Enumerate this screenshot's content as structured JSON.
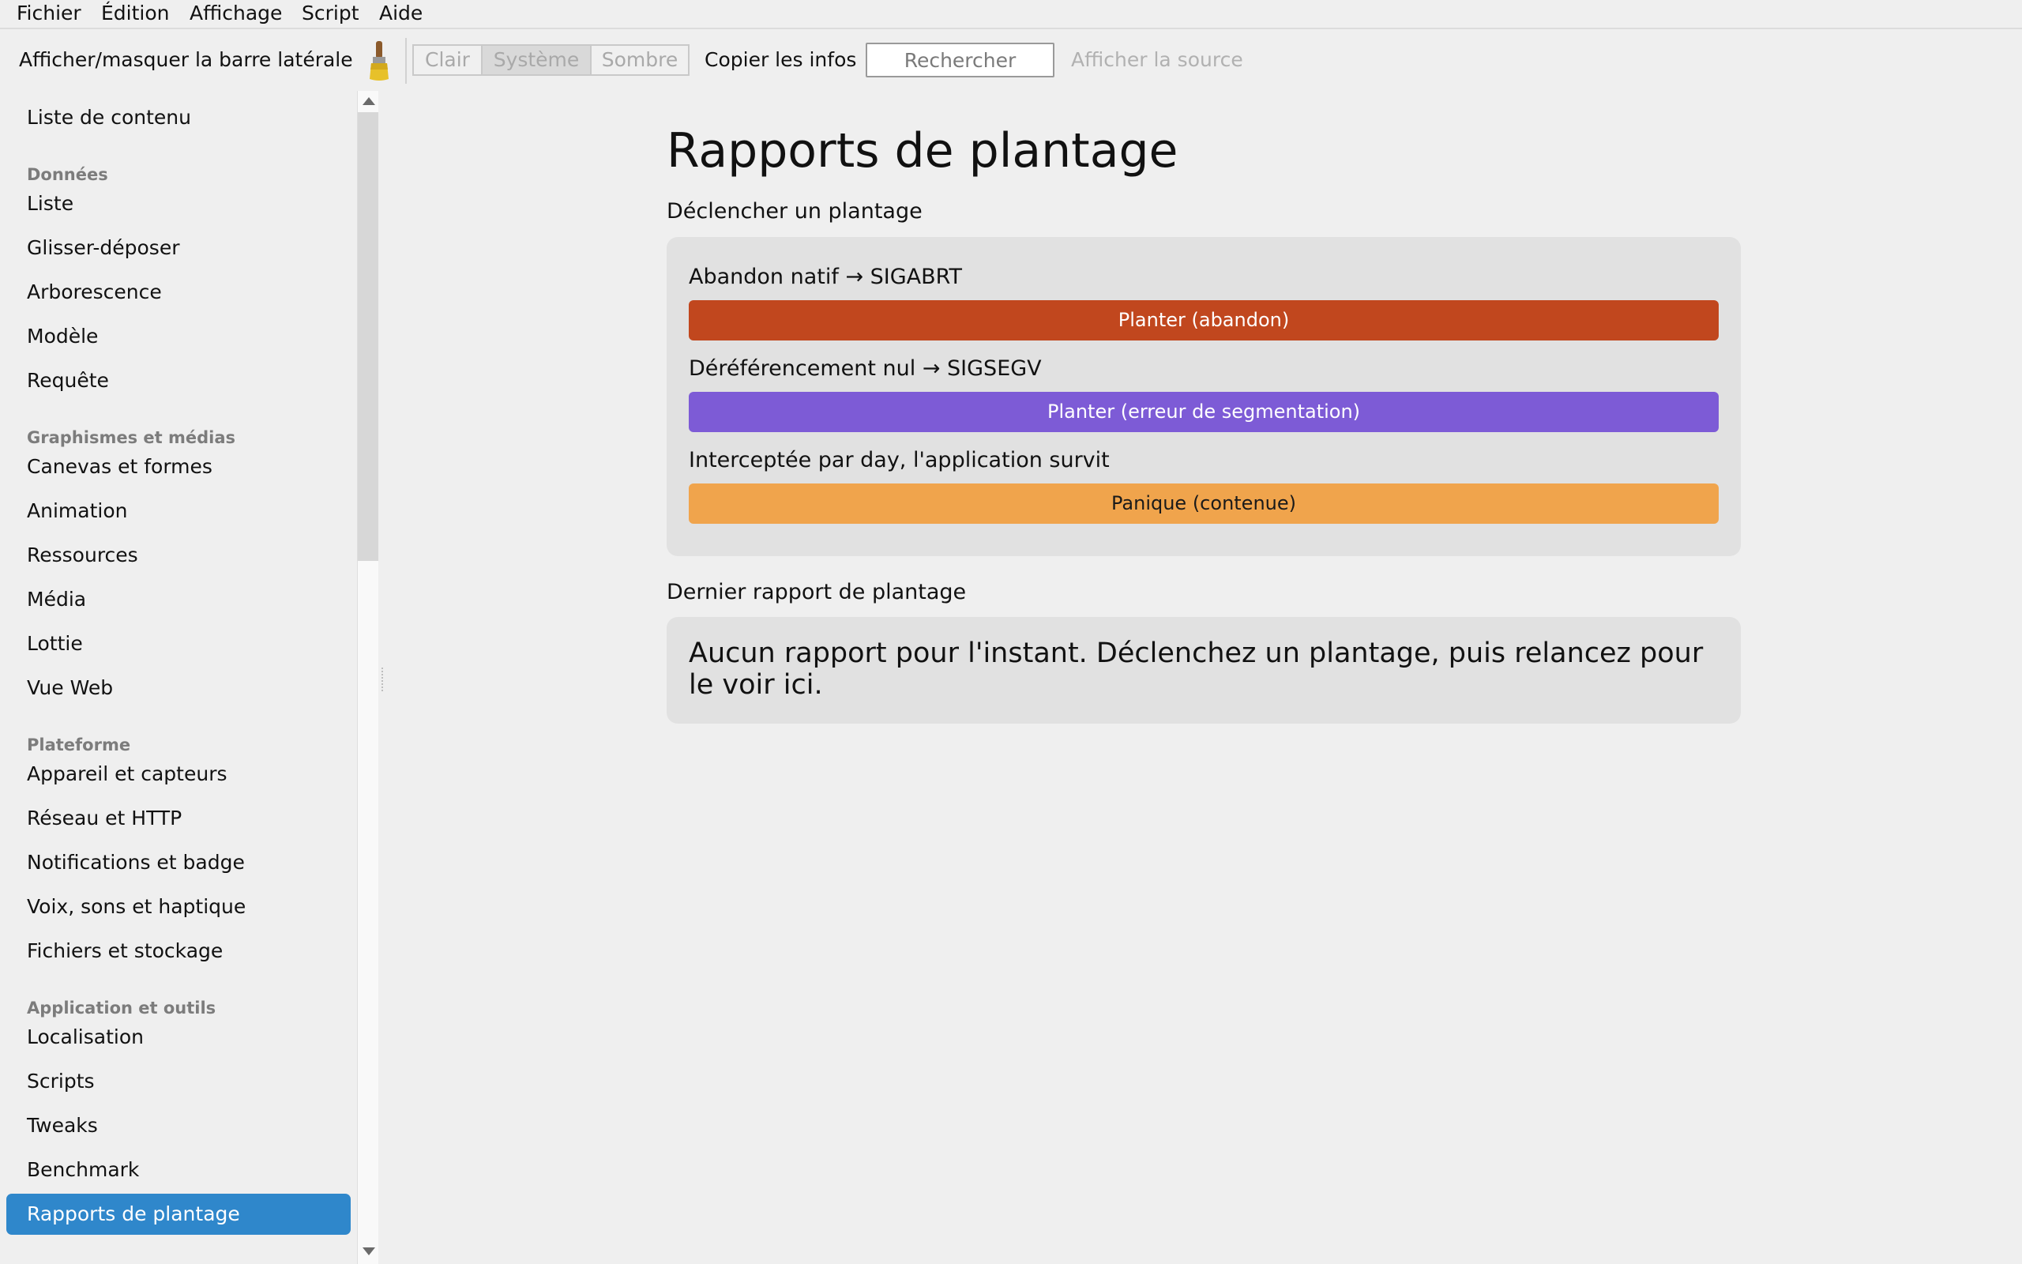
{
  "menubar": {
    "items": [
      "Fichier",
      "Édition",
      "Affichage",
      "Script",
      "Aide"
    ]
  },
  "toolbar": {
    "toggle_sidebar_label": "Afficher/masquer la barre latérale",
    "theme_options": [
      "Clair",
      "Système",
      "Sombre"
    ],
    "active_theme": "Système",
    "copy_info_label": "Copier les infos",
    "search_placeholder": "Rechercher",
    "view_source_label": "Afficher la source",
    "brush_icon": "paintbrush-icon"
  },
  "sidebar": {
    "items": [
      {
        "type": "item",
        "label": "Liste de contenu"
      },
      {
        "type": "header",
        "label": "Données"
      },
      {
        "type": "item",
        "label": "Liste"
      },
      {
        "type": "item",
        "label": "Glisser-déposer"
      },
      {
        "type": "item",
        "label": "Arborescence"
      },
      {
        "type": "item",
        "label": "Modèle"
      },
      {
        "type": "item",
        "label": "Requête"
      },
      {
        "type": "header",
        "label": "Graphismes et médias"
      },
      {
        "type": "item",
        "label": "Canevas et formes"
      },
      {
        "type": "item",
        "label": "Animation"
      },
      {
        "type": "item",
        "label": "Ressources"
      },
      {
        "type": "item",
        "label": "Média"
      },
      {
        "type": "item",
        "label": "Lottie"
      },
      {
        "type": "item",
        "label": "Vue Web"
      },
      {
        "type": "header",
        "label": "Plateforme"
      },
      {
        "type": "item",
        "label": "Appareil et capteurs"
      },
      {
        "type": "item",
        "label": "Réseau et HTTP"
      },
      {
        "type": "item",
        "label": "Notifications et badge"
      },
      {
        "type": "item",
        "label": "Voix, sons et haptique"
      },
      {
        "type": "item",
        "label": "Fichiers et stockage"
      },
      {
        "type": "header",
        "label": "Application et outils"
      },
      {
        "type": "item",
        "label": "Localisation"
      },
      {
        "type": "item",
        "label": "Scripts"
      },
      {
        "type": "item",
        "label": "Tweaks"
      },
      {
        "type": "item",
        "label": "Benchmark"
      },
      {
        "type": "item",
        "label": "Rapports de plantage",
        "selected": true
      }
    ]
  },
  "main": {
    "title": "Rapports de plantage",
    "trigger_section": {
      "label": "Déclencher un plantage",
      "actions": [
        {
          "description": "Abandon natif → SIGABRT",
          "button": "Planter (abandon)",
          "color": "#c1471e",
          "text_color": "#ffffff"
        },
        {
          "description": "Déréférencement nul → SIGSEGV",
          "button": "Planter (erreur de segmentation)",
          "color": "#7d5bd6",
          "text_color": "#ffffff"
        },
        {
          "description": "Interceptée par day, l'application survit",
          "button": "Panique (contenue)",
          "color": "#f0a44c",
          "text_color": "#1a1a1a"
        }
      ]
    },
    "report_section": {
      "label": "Dernier rapport de plantage",
      "text": "Aucun rapport pour l'instant. Déclenchez un plantage, puis relancez pour le voir ici."
    }
  },
  "colors": {
    "selection": "#2f87cb",
    "background": "#efefef",
    "card": "#e1e1e1"
  }
}
